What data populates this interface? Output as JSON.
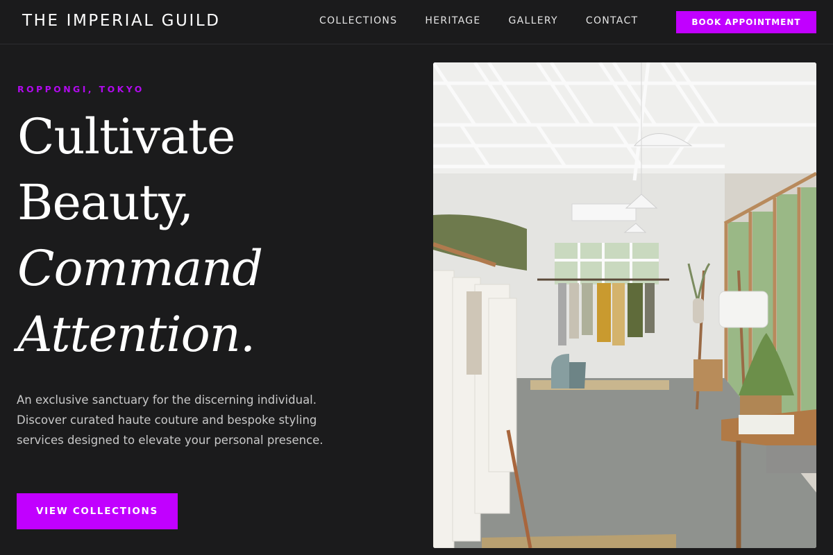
{
  "header": {
    "brand": "THE IMPERIAL GUILD",
    "nav": [
      {
        "label": "COLLECTIONS"
      },
      {
        "label": "HERITAGE"
      },
      {
        "label": "GALLERY"
      },
      {
        "label": "CONTACT"
      }
    ],
    "cta_label": "BOOK APPOINTMENT"
  },
  "hero": {
    "eyebrow": "ROPPONGI, TOKYO",
    "headline": {
      "line1": "Cultivate",
      "line2": "Beauty,",
      "line3": "Command",
      "line4": "Attention."
    },
    "description": "An exclusive sanctuary for the discerning individual. Discover curated haute couture and bespoke styling services designed to elevate your personal presence.",
    "cta_label": "VIEW COLLECTIONS",
    "image_alt": "Boutique interior with clothing racks"
  },
  "colors": {
    "background": "#1b1b1c",
    "accent": "#c100ff",
    "eyebrow": "#b10aee"
  }
}
